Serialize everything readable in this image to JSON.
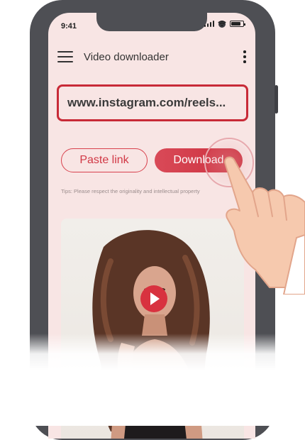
{
  "status_bar": {
    "time": "9:41"
  },
  "app_bar": {
    "title": "Video downloader"
  },
  "url_input": {
    "value": "www.instagram.com/reels..."
  },
  "buttons": {
    "paste": "Paste link",
    "download": "Download"
  },
  "tips": "Tips: Please respect the originality and intellectual property",
  "icons": {
    "menu": "hamburger-menu-icon",
    "more": "more-vertical-icon",
    "play": "play-icon",
    "signal": "signal-icon",
    "wifi": "wifi-icon",
    "battery": "battery-icon"
  },
  "colors": {
    "accent": "#d13845",
    "screen_bg": "#f8e5e4",
    "phone_frame": "#4e4f54"
  }
}
